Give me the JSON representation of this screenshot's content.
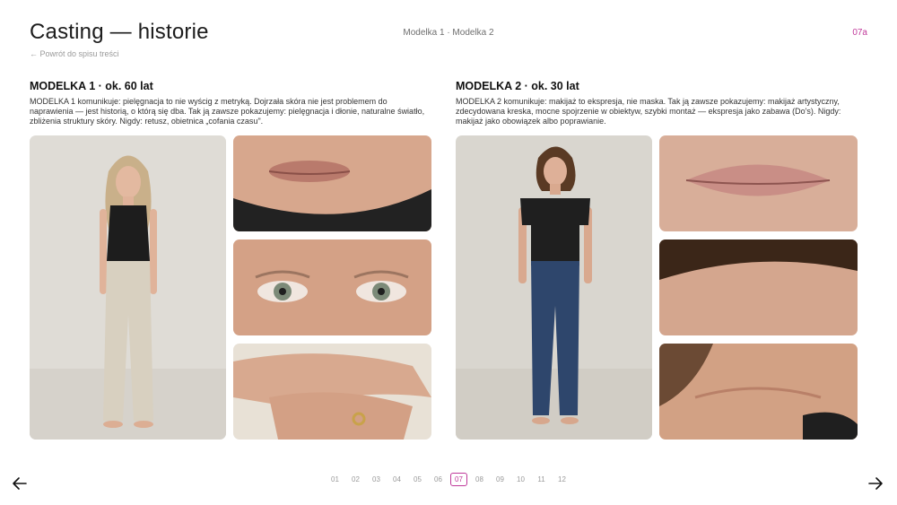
{
  "header": {
    "title": "Casting — historie",
    "back_link": "← Powrót do spisu treści",
    "center_nav": "Modelka 1 · Modelka 2",
    "slide_code": "07a"
  },
  "model1": {
    "heading": "MODELKA 1 · ok. 60 lat",
    "description": "MODELKA 1 komunikuje: pielęgnacja to nie wyścig z metryką. Dojrzała skóra nie jest problemem do naprawienia — jest historią, o którą się dba. Tak ją zawsze pokazujemy: pielęgnacja i dłonie, naturalne światło, zbliżenia struktury skóry. Nigdy: retusz, obietnica „cofania czasu\"."
  },
  "model2": {
    "heading": "MODELKA 2 · ok. 30 lat",
    "description": "MODELKA 2 komunikuje: makijaż to ekspresja, nie maska. Tak ją zawsze pokazujemy: makijaż artystyczny, zdecydowana kreska, mocne spojrzenie w obiektyw, szybki montaż — ekspresja jako zabawa (Do's). Nigdy: makijaż jako obowiązek albo poprawianie."
  },
  "pagination": {
    "pages": [
      "01",
      "02",
      "03",
      "04",
      "05",
      "06",
      "07",
      "08",
      "09",
      "10",
      "11",
      "12"
    ],
    "current": "07"
  },
  "colors": {
    "accent": "#c0399a",
    "photo_background": "#dcd9d3",
    "skin": "#d9a88c"
  },
  "icons": {
    "prev": "arrow-left-icon",
    "next": "arrow-right-icon"
  }
}
